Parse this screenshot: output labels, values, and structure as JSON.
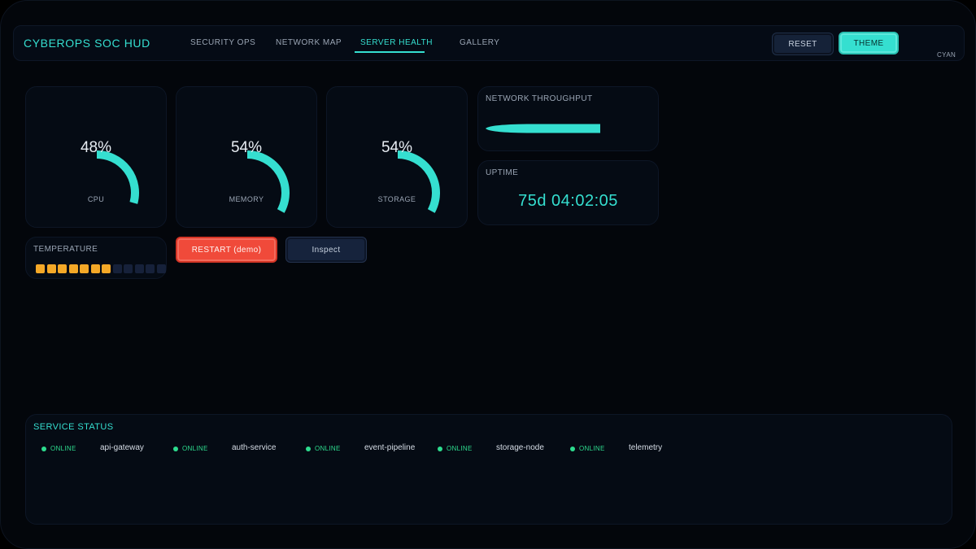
{
  "app": {
    "title": "CYBEROPS SOC HUD",
    "accent_color": "#35dfd0"
  },
  "nav": {
    "tabs": [
      {
        "label": "SECURITY OPS",
        "active": false
      },
      {
        "label": "NETWORK MAP",
        "active": false
      },
      {
        "label": "SERVER HEALTH",
        "active": true
      },
      {
        "label": "GALLERY",
        "active": false
      }
    ]
  },
  "toolbar": {
    "reset_label": "RESET",
    "theme_label": "THEME",
    "theme_name": "CYAN"
  },
  "gauges": [
    {
      "label": "CPU",
      "value_text": "48%",
      "value": 48
    },
    {
      "label": "MEMORY",
      "value_text": "54%",
      "value": 54
    },
    {
      "label": "STORAGE",
      "value_text": "54%",
      "value": 54
    }
  ],
  "throughput": {
    "title": "NETWORK THROUGHPUT"
  },
  "uptime": {
    "title": "UPTIME",
    "value": "75d 04:02:05"
  },
  "temperature": {
    "title": "TEMPERATURE",
    "segments_total": 12,
    "segments_filled": 7,
    "fill_color": "#f4a827"
  },
  "actions": {
    "restart_label": "RESTART (demo)",
    "inspect_label": "Inspect",
    "restart_color": "#f04a3a"
  },
  "service_status": {
    "title": "SERVICE STATUS",
    "status_color": "#2ddc8e",
    "services": [
      {
        "state": "ONLINE",
        "name": "api-gateway"
      },
      {
        "state": "ONLINE",
        "name": "auth-service"
      },
      {
        "state": "ONLINE",
        "name": "event-pipeline"
      },
      {
        "state": "ONLINE",
        "name": "storage-node"
      },
      {
        "state": "ONLINE",
        "name": "telemetry"
      }
    ]
  }
}
